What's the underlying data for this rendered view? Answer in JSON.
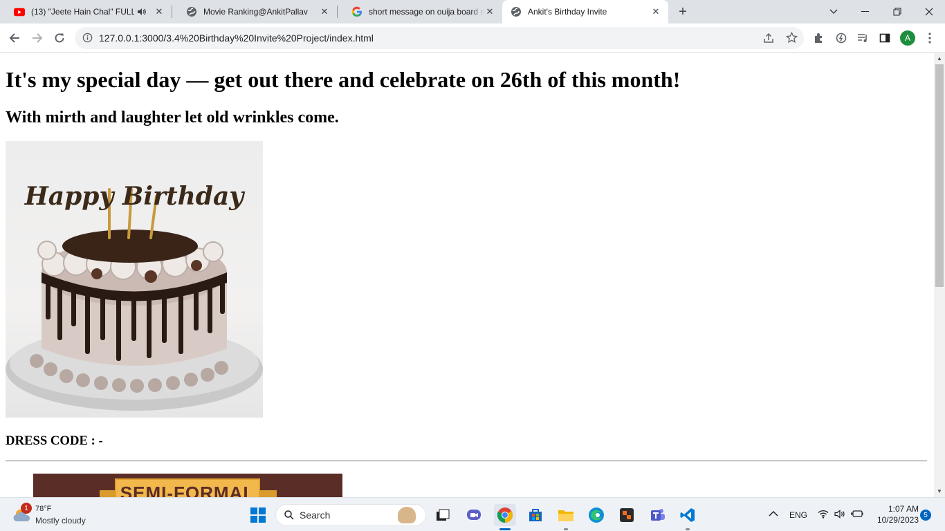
{
  "tabs": [
    {
      "title": "(13) \"Jeete Hain Chal\" FULL",
      "favicon": "youtube-icon",
      "audio": true,
      "active": false
    },
    {
      "title": "Movie Ranking@AnkitPallav",
      "favicon": "globe-icon",
      "active": false
    },
    {
      "title": "short message on ouija board m",
      "favicon": "google-icon",
      "active": false
    },
    {
      "title": "Ankit's Birthday Invite",
      "favicon": "globe-icon",
      "active": true
    }
  ],
  "toolbar": {
    "url": "127.0.0.1:3000/3.4%20Birthday%20Invite%20Project/index.html",
    "profile_initial": "A"
  },
  "page": {
    "heading": "It's my special day — get out there and celebrate on 26th of this month!",
    "subheading": "With mirth and laughter let old wrinkles come.",
    "cake_topper": "Happy Birthday",
    "dress_code_label": "DRESS CODE : -",
    "dress_banner": "SEMI-FORMAL"
  },
  "taskbar": {
    "weather_badge": "1",
    "temperature": "78°F",
    "weather": "Mostly cloudy",
    "search_label": "Search",
    "language": "ENG",
    "time": "1:07 AM",
    "date": "10/29/2023",
    "notification_count": "5"
  },
  "colors": {
    "tabstrip": "#dee1e6",
    "taskbar": "#eef2f7",
    "dress_banner_bg": "#5a2d26",
    "dress_banner_fg": "#f2b84b",
    "profile": "#1e8e3e"
  }
}
